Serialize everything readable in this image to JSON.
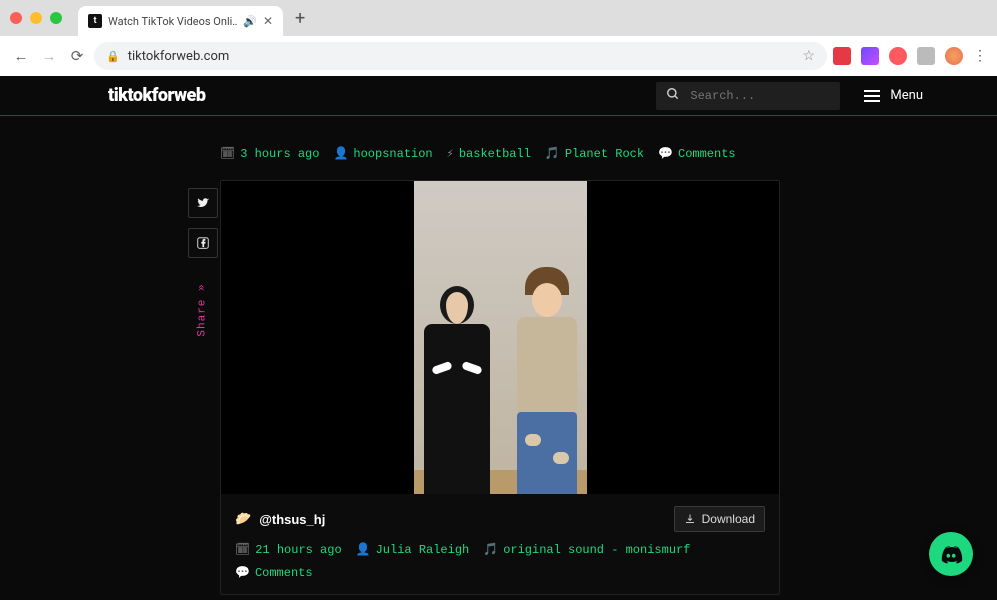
{
  "browser": {
    "tab_title": "Watch TikTok Videos Onli…",
    "url": "tiktokforweb.com"
  },
  "header": {
    "brand": "tiktokforweb",
    "search_placeholder": "Search...",
    "menu_label": "Menu"
  },
  "prev_post_meta": {
    "time": "3 hours ago",
    "user": "hoopsnation",
    "tag": "basketball",
    "sound": "Planet Rock",
    "comments_label": "Comments"
  },
  "post": {
    "handle_emoji": "🥟",
    "handle": "@thsus_hj",
    "download_label": "Download",
    "time": "21 hours ago",
    "user": "Julia Raleigh",
    "sound": "original sound - monismurf",
    "comments_label": "Comments"
  },
  "share": {
    "label": "Share »"
  }
}
